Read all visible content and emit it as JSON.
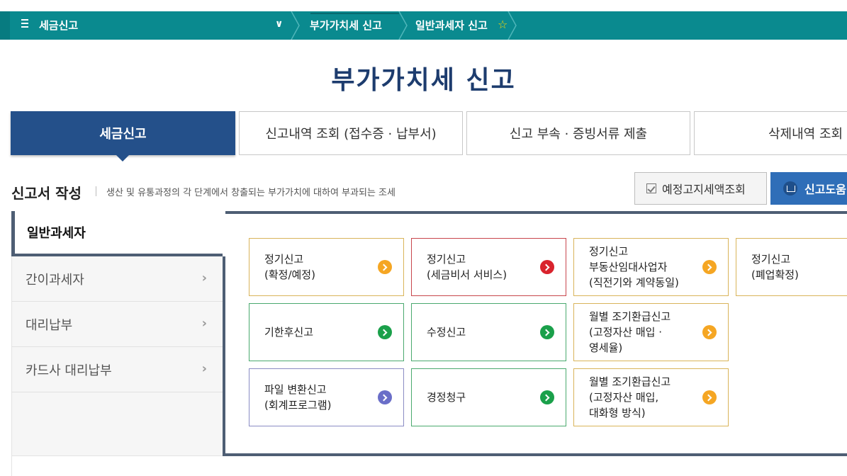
{
  "topbar": {
    "menu_title": "세금신고",
    "crumbs": [
      "부가가치세 신고",
      "일반과세자 신고"
    ]
  },
  "page": {
    "title": "부가가치세 신고"
  },
  "tabs": [
    {
      "label": "세금신고",
      "active": true
    },
    {
      "label": "신고내역 조회 (접수증 · 납부서)",
      "active": false
    },
    {
      "label": "신고 부속 · 증빙서류 제출",
      "active": false
    },
    {
      "label": "삭제내역 조회",
      "active": false
    }
  ],
  "section": {
    "title": "신고서 작성",
    "description": "생산 및 유통과정의 각 단계에서 창출되는 부가가치에 대하여 부과되는 조세"
  },
  "buttons": {
    "notice": "예정고지세액조회",
    "help": "신고도움"
  },
  "side_menu": [
    {
      "label": "일반과세자",
      "active": true
    },
    {
      "label": "간이과세자",
      "active": false
    },
    {
      "label": "대리납부",
      "active": false
    },
    {
      "label": "카드사 대리납부",
      "active": false
    }
  ],
  "cards": [
    {
      "line1": "정기신고",
      "line2": "(확정/예정)",
      "line3": "",
      "color": "#f5a623",
      "border": "#d9b45a"
    },
    {
      "line1": "정기신고",
      "line2": "(세금비서 서비스)",
      "line3": "",
      "color": "#d9232d",
      "border": "#c8464c"
    },
    {
      "line1": "정기신고",
      "line2": "부동산임대사업자",
      "line3": "(직전기와 계약동일)",
      "color": "#f5a623",
      "border": "#d9b45a"
    },
    {
      "line1": "정기신고",
      "line2": "(폐업확정)",
      "line3": "",
      "color": "#f5a623",
      "border": "#d9b45a"
    },
    {
      "line1": "기한후신고",
      "line2": "",
      "line3": "",
      "color": "#1aa04a",
      "border": "#4aa96e"
    },
    {
      "line1": "수정신고",
      "line2": "",
      "line3": "",
      "color": "#1aa04a",
      "border": "#4aa96e"
    },
    {
      "line1": "월별 조기환급신고",
      "line2": "(고정자산 매입 ·",
      "line3": "영세율)",
      "color": "#f5a623",
      "border": "#d9b45a"
    },
    {
      "line1": "파일 변환신고",
      "line2": "(회계프로그램)",
      "line3": "",
      "color": "#6a6ec8",
      "border": "#8a8cc4"
    },
    {
      "line1": "경정청구",
      "line2": "",
      "line3": "",
      "color": "#1aa04a",
      "border": "#4aa96e"
    },
    {
      "line1": "월별 조기환급신고",
      "line2": "(고정자산 매입,",
      "line3": "대화형 방식)",
      "color": "#f5a623",
      "border": "#d9b45a"
    }
  ],
  "colors": {
    "topbar": "#0a8a8f",
    "active_tab": "#24508a",
    "title": "#1d3c6e",
    "panel_border": "#4e5e74",
    "help_button": "#2f6eb8"
  }
}
